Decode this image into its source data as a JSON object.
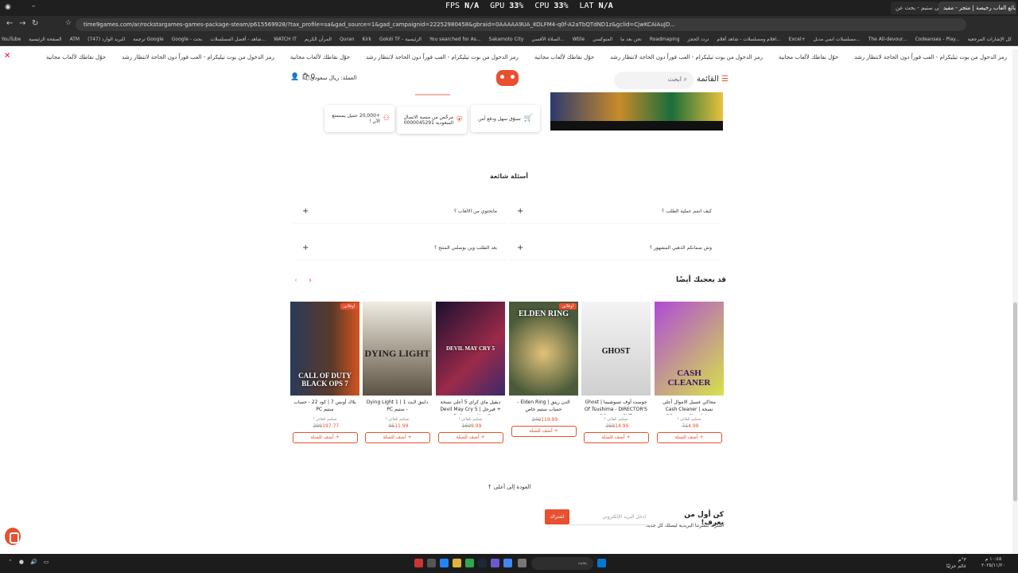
{
  "browser": {
    "tabs": [
      {
        "label": "لعبة بولين على ستيم - بحث عن...",
        "active": false
      },
      {
        "label": "بائع العاب رخيصة | متجر - مفيد ...",
        "active": true
      }
    ],
    "overlay": {
      "fps_label": "FPS",
      "fps_value": "N/A",
      "gpu_label": "GPU",
      "gpu_value": "33",
      "gpu_unit": "%",
      "cpu_label": "CPU",
      "cpu_value": "33",
      "cpu_unit": "%",
      "lat_label": "LAT",
      "lat_value": "N/A"
    },
    "url": "time9games.com/ar/rockstargames-games-package-steam/p615569928/?tax_profile=sa&gad_source=1&gad_campaignid=22252980458&gbraid=0AAAAA9UA_KOLFM4-q0f-A2aTbQTdND1z&gclid=CjwKCAiAuJD..."
  },
  "bookmarks": [
    "كل الإشارات المرجعية",
    "Codeanses - Play...",
    "The All-devour...",
    "مسلسلات انمي مدبل...",
    "Excel+",
    "افلام ومسلسلات - شاهد أفلام...",
    "تردد الحجز",
    "Roadmaping",
    "نحن بعد ما",
    "المتوكسي",
    "Wtile",
    "الصلاة الأقسي...",
    "Sakamoto City",
    "You searched for As...",
    "Gokdi TF - الرئيسية",
    "Kirk",
    "Quran",
    "المرآن الكريم",
    "WATCH IT",
    "شاهد - أفضل المسلسلات...",
    "Google - بحث",
    "ترجمة Google",
    "(747) البريد الوارد",
    "ATM",
    "الصفحة الرئيسية",
    "YouTube",
    "N"
  ],
  "ticker": {
    "items": [
      "رمز الدخول من بوت تيليكرام - العب فوراً دون الحاجة لانتظار رشد",
      "حوّل نقاطك لألعاب مجانية",
      "رمز الدخول من بوت تيليكرام - العب فوراً دون الحاجة لانتظار رشد",
      "حوّل نقاطك لألعاب مجانية",
      "رمز الدخول من بوت تيليكرام - العب فوراً دون الحاجة لانتظار رشد",
      "حوّل نقاطك لألعاب مجانية",
      "رمز الدخول من بوت تيليكرام - العب فوراً دون الحاجة لانتظار رشد",
      "حوّل نقاطك لألعاب مجانية"
    ],
    "close": "✕"
  },
  "header": {
    "menu_label": "القائمة",
    "search_placeholder": "ابحث",
    "currency": "العملة: ريال سعودي",
    "cart_count": "0"
  },
  "features": [
    {
      "label": "تسوّق سهل ودفع آمن",
      "icon": "cart-icon"
    },
    {
      "label": "مرخّص من منصة الاتصال السعودية 0000045291",
      "icon": "shield-icon"
    },
    {
      "label": "+20,000 عميل يستمتع الآن !",
      "icon": "users-icon"
    }
  ],
  "faq": {
    "title": "أسئلة شائعة",
    "items": [
      {
        "q": "كيف اتمم عملية الطلب ؟"
      },
      {
        "q": "ماتحتوي من الالعاب ؟"
      },
      {
        "q": "وش ضمانكم الذهبي المشهور ؟"
      },
      {
        "q": "بعد الطلب وين بوصلني المنتج ؟"
      }
    ]
  },
  "recommendations": {
    "title": "قد يعجبك أيضًا",
    "prev": "›",
    "next": "‹",
    "products": [
      {
        "name": "محاكي غسيل الاموال أعلى نسخة | Cash Cleaner Simulator - ستيم PC",
        "delivery": "تسليم تلقائي !",
        "old_price": "71",
        "new_price": "4.99",
        "add": "+ أضف للسلة",
        "badge": "",
        "img_title": "CASH CLEANER",
        "colors": [
          "#b04bd6",
          "#d6e24a"
        ]
      },
      {
        "name": "جوست أوف تسوشيما | Ghost Of Tsushima - DIRECTOR'S CUT - ستيم PC",
        "delivery": "تسليم تلقائي !",
        "old_price": "259",
        "new_price": "14.99",
        "add": "+ أضف للسلة",
        "badge": "",
        "img_title": "GHOST",
        "colors": [
          "#f2f2f2",
          "#c9c9c9"
        ]
      },
      {
        "name": "الدن رينق | Elden Ring - حساب ستيم خاص",
        "delivery": "",
        "old_price": "249",
        "new_price": "119.99",
        "add": "+ أضف للسلة",
        "badge": "أوفلاين",
        "img_title": "ELDEN RING",
        "colors": [
          "#4a5a3a",
          "#b7a36a"
        ]
      },
      {
        "name": "ديفيل ماي كراي 5 أعلى نسخة + فيرجل | Devil May Cry 5 Deluxe + Vergil -",
        "delivery": "تسليم تلقائي !",
        "old_price": "160",
        "new_price": "9.99",
        "add": "+ أضف للسلة",
        "badge": "",
        "img_title": "DEVIL MAY CRY 5",
        "colors": [
          "#2a1b3d",
          "#9b2a4a"
        ]
      },
      {
        "name": "داينق لايت 1 | Dying Light 1 - ستيم PC",
        "delivery": "تسليم تلقائي !",
        "old_price": "95",
        "new_price": "11.99",
        "add": "+ أضف للسلة",
        "badge": "",
        "img_title": "DYING LIGHT",
        "colors": [
          "#e8e4dc",
          "#6b6358"
        ]
      },
      {
        "name": "بلاك أوبس 7 | كود 22 - حساب ستيم PC",
        "delivery": "تسليم تلقائي !",
        "old_price": "299",
        "new_price": "197.77",
        "add": "+ أضف للسلة",
        "badge": "أوفلاين",
        "img_title": "CALL OF DUTY BLACK OPS 7",
        "colors": [
          "#2a3a5a",
          "#d4541f"
        ]
      }
    ]
  },
  "back_to_top": "العودة إلى أعلى",
  "newsletter": {
    "title": "كن أول من يعرف!",
    "subtitle": "اشترك بنشرتنا البريدية ليصلك كل جديد.",
    "placeholder": "ادخل البريد الإلكتروني",
    "button": "اشتراك"
  },
  "taskbar": {
    "search_placeholder": "بحث",
    "time": "١٠:٤٥ م",
    "date": "٢٠٢٥/١١/٢٠",
    "weather": "٣°م",
    "weather_desc": "غائم جزئيًا"
  },
  "colors": {
    "accent": "#e8502f",
    "chrome": "#2b2b2b"
  }
}
